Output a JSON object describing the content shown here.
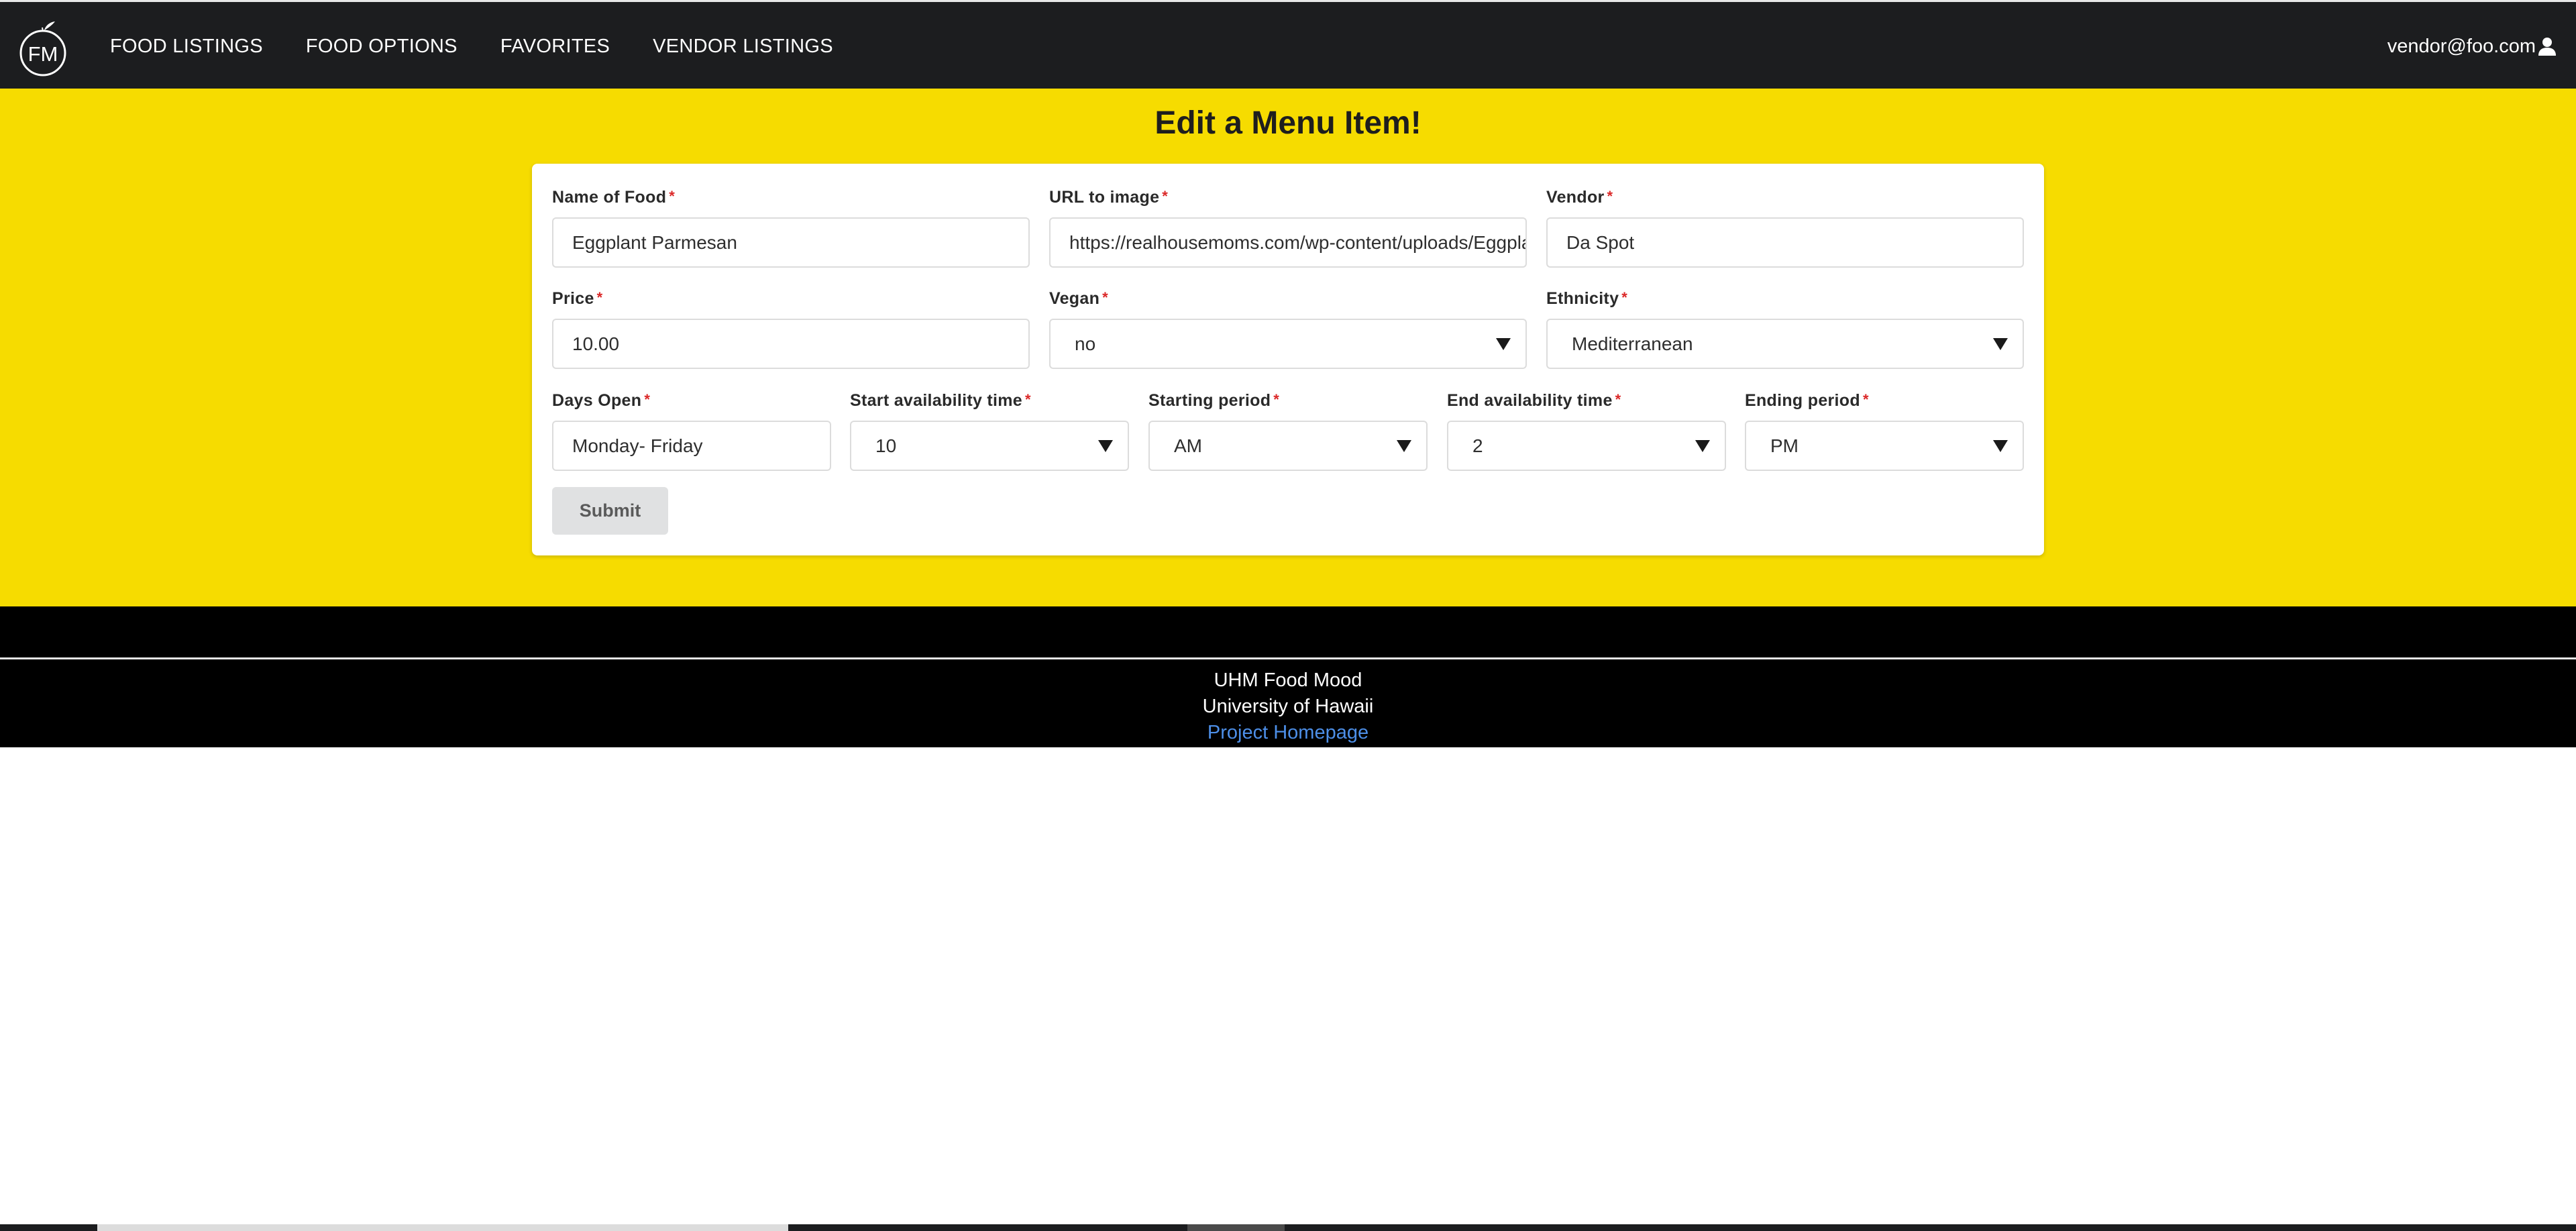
{
  "app": {
    "logo_text": "FM"
  },
  "nav": {
    "items": [
      "FOOD LISTINGS",
      "FOOD OPTIONS",
      "FAVORITES",
      "VENDOR LISTINGS"
    ],
    "user": "vendor@foo.com"
  },
  "page": {
    "title": "Edit a Menu Item!"
  },
  "form": {
    "name_of_food": {
      "label": "Name of Food",
      "value": "Eggplant Parmesan"
    },
    "url_to_image": {
      "label": "URL to image",
      "value": "https://realhousemoms.com/wp-content/uploads/Eggplant-Parmesan-IG.jpg"
    },
    "vendor": {
      "label": "Vendor",
      "value": "Da Spot"
    },
    "price": {
      "label": "Price",
      "value": "10.00"
    },
    "vegan": {
      "label": "Vegan",
      "value": "no"
    },
    "ethnicity": {
      "label": "Ethnicity",
      "value": "Mediterranean"
    },
    "days_open": {
      "label": "Days Open",
      "value": "Monday- Friday"
    },
    "start_time": {
      "label": "Start availability time",
      "value": "10"
    },
    "starting_period": {
      "label": "Starting period",
      "value": "AM"
    },
    "end_time": {
      "label": "End availability time",
      "value": "2"
    },
    "ending_period": {
      "label": "Ending period",
      "value": "PM"
    },
    "required_mark": "*",
    "submit_label": "Submit"
  },
  "footer": {
    "line1": "UHM Food Mood",
    "line2": "University of Hawaii",
    "link": "Project Homepage"
  },
  "colors": {
    "navbar": "#1c1d1f",
    "main_background": "#f6dc00",
    "footer": "#000000",
    "link": "#4d8fe8",
    "required": "#db2828"
  }
}
